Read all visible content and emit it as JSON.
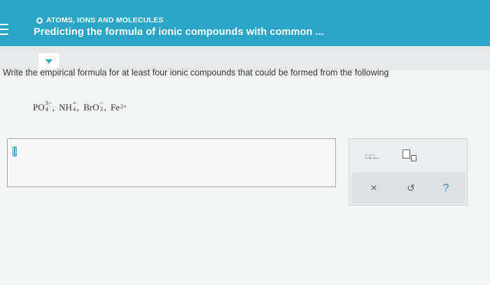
{
  "header": {
    "topic": "ATOMS, IONS AND MOLECULES",
    "title": "Predicting the formula of ionic compounds with common ..."
  },
  "question": {
    "text": "Write the empirical formula for at least four ionic compounds that could be formed from the following"
  },
  "ions": [
    {
      "base": "PO",
      "sub": "4",
      "sup": "3−"
    },
    {
      "base": "NH",
      "sub": "4",
      "sup": "+"
    },
    {
      "base": "BrO",
      "sub": "3",
      "sup": "−"
    },
    {
      "base": "Fe",
      "sub": "",
      "sup": "2+"
    }
  ],
  "answer": {
    "value": ""
  },
  "tools": {
    "multi_label": "□,□,...",
    "clear_glyph": "×",
    "undo_glyph": "↺",
    "help_glyph": "?"
  },
  "colors": {
    "accent": "#2ba5c7",
    "help": "#2b93c4"
  }
}
